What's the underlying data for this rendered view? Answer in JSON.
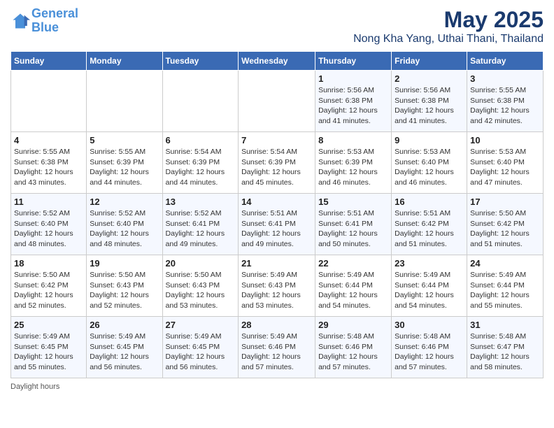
{
  "header": {
    "logo_line1": "General",
    "logo_line2": "Blue",
    "title": "May 2025",
    "subtitle": "Nong Kha Yang, Uthai Thani, Thailand"
  },
  "days_of_week": [
    "Sunday",
    "Monday",
    "Tuesday",
    "Wednesday",
    "Thursday",
    "Friday",
    "Saturday"
  ],
  "weeks": [
    [
      {
        "day": "",
        "info": ""
      },
      {
        "day": "",
        "info": ""
      },
      {
        "day": "",
        "info": ""
      },
      {
        "day": "",
        "info": ""
      },
      {
        "day": "1",
        "info": "Sunrise: 5:56 AM\nSunset: 6:38 PM\nDaylight: 12 hours and 41 minutes."
      },
      {
        "day": "2",
        "info": "Sunrise: 5:56 AM\nSunset: 6:38 PM\nDaylight: 12 hours and 41 minutes."
      },
      {
        "day": "3",
        "info": "Sunrise: 5:55 AM\nSunset: 6:38 PM\nDaylight: 12 hours and 42 minutes."
      }
    ],
    [
      {
        "day": "4",
        "info": "Sunrise: 5:55 AM\nSunset: 6:38 PM\nDaylight: 12 hours and 43 minutes."
      },
      {
        "day": "5",
        "info": "Sunrise: 5:55 AM\nSunset: 6:39 PM\nDaylight: 12 hours and 44 minutes."
      },
      {
        "day": "6",
        "info": "Sunrise: 5:54 AM\nSunset: 6:39 PM\nDaylight: 12 hours and 44 minutes."
      },
      {
        "day": "7",
        "info": "Sunrise: 5:54 AM\nSunset: 6:39 PM\nDaylight: 12 hours and 45 minutes."
      },
      {
        "day": "8",
        "info": "Sunrise: 5:53 AM\nSunset: 6:39 PM\nDaylight: 12 hours and 46 minutes."
      },
      {
        "day": "9",
        "info": "Sunrise: 5:53 AM\nSunset: 6:40 PM\nDaylight: 12 hours and 46 minutes."
      },
      {
        "day": "10",
        "info": "Sunrise: 5:53 AM\nSunset: 6:40 PM\nDaylight: 12 hours and 47 minutes."
      }
    ],
    [
      {
        "day": "11",
        "info": "Sunrise: 5:52 AM\nSunset: 6:40 PM\nDaylight: 12 hours and 48 minutes."
      },
      {
        "day": "12",
        "info": "Sunrise: 5:52 AM\nSunset: 6:40 PM\nDaylight: 12 hours and 48 minutes."
      },
      {
        "day": "13",
        "info": "Sunrise: 5:52 AM\nSunset: 6:41 PM\nDaylight: 12 hours and 49 minutes."
      },
      {
        "day": "14",
        "info": "Sunrise: 5:51 AM\nSunset: 6:41 PM\nDaylight: 12 hours and 49 minutes."
      },
      {
        "day": "15",
        "info": "Sunrise: 5:51 AM\nSunset: 6:41 PM\nDaylight: 12 hours and 50 minutes."
      },
      {
        "day": "16",
        "info": "Sunrise: 5:51 AM\nSunset: 6:42 PM\nDaylight: 12 hours and 51 minutes."
      },
      {
        "day": "17",
        "info": "Sunrise: 5:50 AM\nSunset: 6:42 PM\nDaylight: 12 hours and 51 minutes."
      }
    ],
    [
      {
        "day": "18",
        "info": "Sunrise: 5:50 AM\nSunset: 6:42 PM\nDaylight: 12 hours and 52 minutes."
      },
      {
        "day": "19",
        "info": "Sunrise: 5:50 AM\nSunset: 6:43 PM\nDaylight: 12 hours and 52 minutes."
      },
      {
        "day": "20",
        "info": "Sunrise: 5:50 AM\nSunset: 6:43 PM\nDaylight: 12 hours and 53 minutes."
      },
      {
        "day": "21",
        "info": "Sunrise: 5:49 AM\nSunset: 6:43 PM\nDaylight: 12 hours and 53 minutes."
      },
      {
        "day": "22",
        "info": "Sunrise: 5:49 AM\nSunset: 6:44 PM\nDaylight: 12 hours and 54 minutes."
      },
      {
        "day": "23",
        "info": "Sunrise: 5:49 AM\nSunset: 6:44 PM\nDaylight: 12 hours and 54 minutes."
      },
      {
        "day": "24",
        "info": "Sunrise: 5:49 AM\nSunset: 6:44 PM\nDaylight: 12 hours and 55 minutes."
      }
    ],
    [
      {
        "day": "25",
        "info": "Sunrise: 5:49 AM\nSunset: 6:45 PM\nDaylight: 12 hours and 55 minutes."
      },
      {
        "day": "26",
        "info": "Sunrise: 5:49 AM\nSunset: 6:45 PM\nDaylight: 12 hours and 56 minutes."
      },
      {
        "day": "27",
        "info": "Sunrise: 5:49 AM\nSunset: 6:45 PM\nDaylight: 12 hours and 56 minutes."
      },
      {
        "day": "28",
        "info": "Sunrise: 5:49 AM\nSunset: 6:46 PM\nDaylight: 12 hours and 57 minutes."
      },
      {
        "day": "29",
        "info": "Sunrise: 5:48 AM\nSunset: 6:46 PM\nDaylight: 12 hours and 57 minutes."
      },
      {
        "day": "30",
        "info": "Sunrise: 5:48 AM\nSunset: 6:46 PM\nDaylight: 12 hours and 57 minutes."
      },
      {
        "day": "31",
        "info": "Sunrise: 5:48 AM\nSunset: 6:47 PM\nDaylight: 12 hours and 58 minutes."
      }
    ]
  ],
  "footer": {
    "text": "Daylight hours"
  }
}
